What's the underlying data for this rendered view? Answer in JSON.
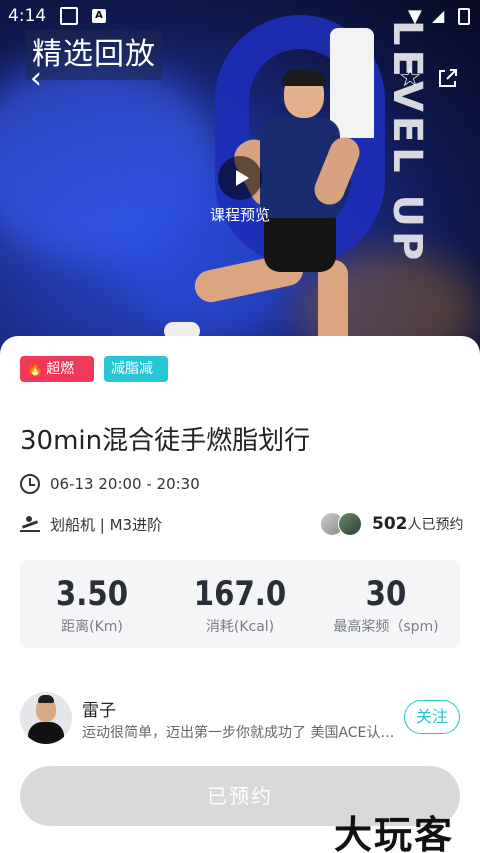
{
  "status_bar": {
    "time": "4:14",
    "app_badge": "A"
  },
  "hero": {
    "title_overlay": "精选回放",
    "brand_text": "LEVEL UP",
    "preview_label": "课程预览"
  },
  "course": {
    "tags": {
      "hot": "超燃脂",
      "fat_loss": "减脂减重"
    },
    "title": "30min混合徒手燃脂划行",
    "time": "06-13 20:00 - 20:30",
    "equipment": "划船机 | M3进阶",
    "booked_count": "502",
    "booked_text": "人已预约"
  },
  "stats": [
    {
      "value": "3.50",
      "label": "距离(Km)"
    },
    {
      "value": "167.0",
      "label": "消耗(Kcal)"
    },
    {
      "value": "30",
      "label": "最高桨频（spm)"
    }
  ],
  "coach": {
    "name": "雷子",
    "bio": "运动很简单，迈出第一步你就成功了 美国ACE认证教练",
    "follow_label": "关注"
  },
  "action": {
    "reserved_label": "已预约"
  },
  "watermark": "大玩客",
  "colors": {
    "hot_tag": "#f0385a",
    "fat_tag": "#26c6d6",
    "accent": "#2bc2d0",
    "disabled_button": "#d9d9dc"
  }
}
